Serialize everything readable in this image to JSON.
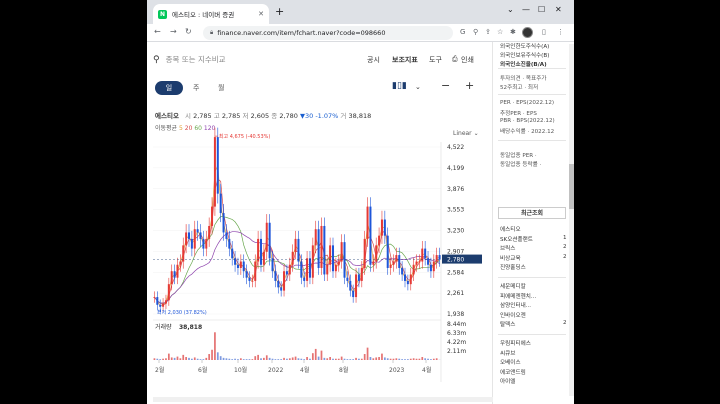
{
  "browser": {
    "tab_title": "에스티오 : 네이버 증권",
    "favicon_letter": "N",
    "url": "finance.naver.com/item/fchart.naver?code=098660"
  },
  "search": {
    "placeholder": "종목 또는 지수비교"
  },
  "top_menu": [
    "공시",
    "보조지표",
    "도구",
    "인쇄"
  ],
  "periods": {
    "active": "일",
    "others": [
      "주",
      "월"
    ]
  },
  "quote": {
    "name": "에스티오",
    "open_label": "시",
    "open": "2,785",
    "high_label": "고",
    "high": "2,785",
    "low_label": "저",
    "low": "2,605",
    "close_label": "종",
    "close": "2,780",
    "change": "▼30 -1.07%",
    "volume_label": "거",
    "volume": "38,818"
  },
  "ma_legend": {
    "label": "이동평균",
    "periods": [
      "5",
      "20",
      "60",
      "120"
    ],
    "colors": [
      "#e3a23a",
      "#d64b4b",
      "#6aa84f",
      "#8e44ad"
    ]
  },
  "scale_mode": "Linear",
  "chart_data": {
    "type": "candlestick",
    "price_ticks": [
      "4,522",
      "4,199",
      "3,876",
      "3,553",
      "3,230",
      "2,907",
      "2,584",
      "2,261",
      "1,938"
    ],
    "price_ylim": [
      1938,
      4522
    ],
    "volume_ticks": [
      "8.44m",
      "6.33m",
      "4.22m",
      "2.11m"
    ],
    "x_labels": [
      "2월",
      "6월",
      "10월",
      "2022",
      "4월",
      "8월",
      "2023",
      "4월"
    ],
    "current_price": "2,780",
    "high_annotation": "최고 4,675 (-40.53%)",
    "low_annotation": "최저 2,030 (37.82%)",
    "volume_label": "거래량",
    "volume_value": "38,818",
    "close": [
      2200,
      2080,
      2050,
      2100,
      2150,
      2400,
      2600,
      2500,
      2700,
      2750,
      3000,
      3200,
      3100,
      2950,
      3250,
      3200,
      3100,
      2950,
      3100,
      3300,
      3600,
      4675,
      3800,
      3500,
      3200,
      3100,
      2950,
      2800,
      2700,
      2650,
      2750,
      2600,
      2500,
      2450,
      2450,
      2750,
      3100,
      2700,
      2900,
      3350,
      2800,
      2600,
      2450,
      2350,
      2300,
      2600,
      2550,
      2700,
      2900,
      3100,
      2750,
      2500,
      2450,
      2800,
      2500,
      3000,
      3250,
      2650,
      3300,
      2550,
      2700,
      3000,
      2600,
      2700,
      2750,
      3050,
      2500,
      2450,
      2300,
      2200,
      2550,
      2450,
      2650,
      3100,
      3600,
      2700,
      2750,
      3000,
      3150,
      3400,
      3150,
      2650,
      2700,
      2750,
      2850,
      2650,
      2550,
      2450,
      2400,
      2550,
      2700,
      2750,
      2750,
      2950,
      2800,
      2700,
      2600,
      2750,
      2850,
      2780
    ],
    "volume": [
      0.4,
      0.3,
      0.2,
      0.3,
      0.4,
      1.5,
      0.6,
      0.5,
      0.8,
      0.4,
      1.2,
      0.7,
      0.5,
      0.3,
      0.6,
      0.3,
      0.2,
      0.2,
      0.5,
      1.4,
      2.4,
      6.5,
      1.8,
      0.9,
      0.5,
      0.4,
      0.3,
      0.2,
      0.3,
      0.2,
      0.4,
      0.2,
      0.2,
      0.2,
      0.2,
      0.9,
      1.2,
      0.4,
      0.5,
      1.1,
      0.5,
      0.3,
      0.2,
      0.2,
      0.2,
      0.5,
      0.3,
      0.4,
      0.6,
      0.8,
      0.4,
      0.3,
      0.2,
      0.7,
      0.3,
      1.6,
      2.6,
      0.8,
      2.2,
      0.5,
      0.4,
      0.7,
      0.3,
      0.3,
      0.3,
      0.8,
      0.3,
      0.2,
      0.2,
      0.2,
      0.5,
      0.3,
      0.3,
      1.4,
      2.9,
      0.7,
      0.4,
      0.6,
      0.7,
      1.5,
      0.6,
      0.4,
      0.3,
      0.3,
      0.4,
      0.3,
      0.2,
      0.2,
      0.2,
      0.3,
      0.4,
      0.3,
      0.3,
      0.7,
      0.4,
      0.3,
      0.2,
      0.3,
      0.4,
      0.04
    ]
  },
  "right_panel": {
    "top_items": [
      "외국인한도주식수(A)",
      "외국인보유주식수(B)",
      "외국인소진율(B/A)"
    ],
    "price_items": [
      "투자의견 · 목표주가",
      "52주최고 · 최저"
    ],
    "per_items": [
      "PER · EPS(2022.12)",
      "추정PER · EPS",
      "PBR · BPS(2022.12)",
      "배당수익률 · 2022.12"
    ],
    "industry_items": [
      "동일업종 PER ·",
      "동일업종 등락률 ·"
    ],
    "recent_header": "최근조회",
    "recent_items": [
      {
        "name": "에스티오",
        "count": ""
      },
      {
        "name": "SK오션플랜트",
        "count": "1"
      },
      {
        "name": "브릭스",
        "count": "2"
      },
      {
        "name": "비상교육",
        "count": "2"
      },
      {
        "name": "진양홀딩스",
        "count": ""
      }
    ],
    "recent_items2": [
      {
        "name": "세운메디칼",
        "count": ""
      },
      {
        "name": "피에메젠헨치...",
        "count": ""
      },
      {
        "name": "삼양인터내...",
        "count": ""
      },
      {
        "name": "인바이오젠",
        "count": ""
      },
      {
        "name": "탈덱스",
        "count": "2"
      }
    ],
    "recent_items3": [
      {
        "name": "우림피티에스",
        "count": ""
      },
      {
        "name": "씨큐브",
        "count": ""
      },
      {
        "name": "오베이스",
        "count": ""
      },
      {
        "name": "에코앤드림",
        "count": ""
      },
      {
        "name": "아이엘",
        "count": ""
      }
    ]
  }
}
